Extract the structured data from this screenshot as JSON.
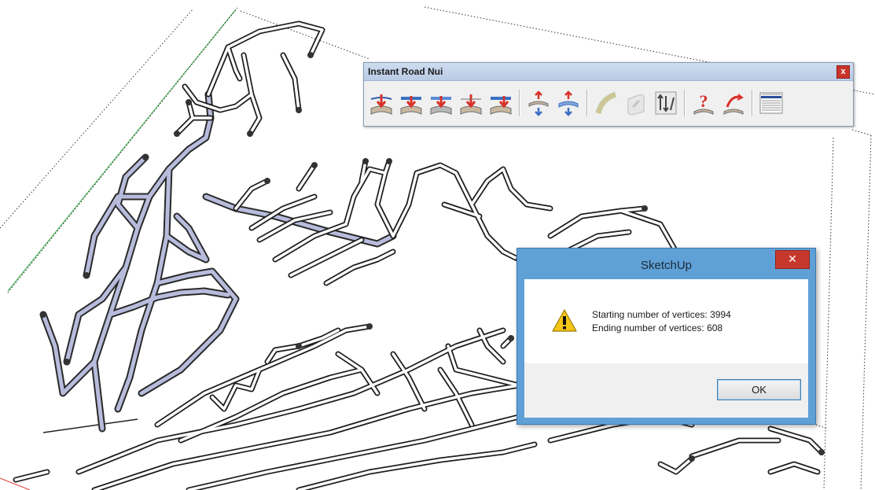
{
  "toolbar": {
    "title": "Instant Road Nui",
    "close_label": "x",
    "tools": [
      {
        "name": "road-from-contours",
        "icon": "road-down-arrow-icon"
      },
      {
        "name": "road-from-contours-2",
        "icon": "road-down-arrow-icon"
      },
      {
        "name": "road-grade",
        "icon": "road-down-arrow-gray-icon"
      },
      {
        "name": "road-down-4",
        "icon": "road-down-arrow-icon"
      },
      {
        "name": "road-down-5",
        "icon": "road-down-arrow-icon"
      },
      {
        "name": "road-vertical-1",
        "icon": "road-updown-arrow-icon"
      },
      {
        "name": "road-vertical-2",
        "icon": "road-updown-arrow-icon"
      },
      {
        "name": "road-curve-1",
        "icon": "road-curve-icon"
      },
      {
        "name": "road-curve-2",
        "icon": "road-curve-disabled-icon"
      },
      {
        "name": "road-arrows",
        "icon": "road-arrows-icon"
      },
      {
        "name": "help",
        "icon": "help-icon"
      },
      {
        "name": "reverse",
        "icon": "reverse-icon"
      },
      {
        "name": "list-menu",
        "icon": "list-icon"
      }
    ]
  },
  "dialog": {
    "title": "SketchUp",
    "close_label": "✕",
    "message_line1": "Starting number of vertices: 3994",
    "message_line2": "Ending number of vertices: 608",
    "ok_label": "OK",
    "icon": "warning-icon"
  }
}
